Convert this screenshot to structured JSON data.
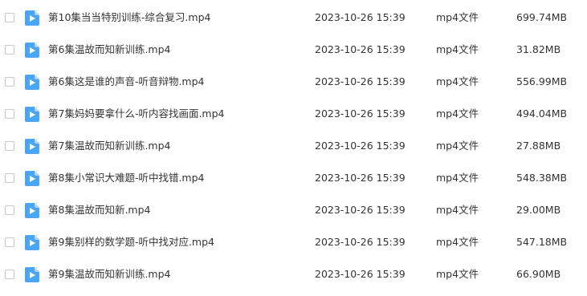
{
  "files": [
    {
      "name": "第10集当当特别训练-综合复习.mp4",
      "modified": "2023-10-26 15:39",
      "type": "mp4文件",
      "size": "699.74MB",
      "icon": "video-file-icon"
    },
    {
      "name": "第6集温故而知新训练.mp4",
      "modified": "2023-10-26 15:39",
      "type": "mp4文件",
      "size": "31.82MB",
      "icon": "video-file-icon"
    },
    {
      "name": "第6集这是谁的声音-听音辩物.mp4",
      "modified": "2023-10-26 15:39",
      "type": "mp4文件",
      "size": "556.99MB",
      "icon": "video-file-icon"
    },
    {
      "name": "第7集妈妈要拿什么-听内容找画面.mp4",
      "modified": "2023-10-26 15:39",
      "type": "mp4文件",
      "size": "494.04MB",
      "icon": "video-file-icon"
    },
    {
      "name": "第7集温故而知新训练.mp4",
      "modified": "2023-10-26 15:39",
      "type": "mp4文件",
      "size": "27.88MB",
      "icon": "video-file-icon"
    },
    {
      "name": "第8集小常识大难题-听中找错.mp4",
      "modified": "2023-10-26 15:39",
      "type": "mp4文件",
      "size": "548.38MB",
      "icon": "video-file-icon"
    },
    {
      "name": "第8集温故而知新.mp4",
      "modified": "2023-10-26 15:39",
      "type": "mp4文件",
      "size": "29.00MB",
      "icon": "video-file-icon"
    },
    {
      "name": "第9集别样的数学题-听中找对应.mp4",
      "modified": "2023-10-26 15:39",
      "type": "mp4文件",
      "size": "547.18MB",
      "icon": "video-file-icon"
    },
    {
      "name": "第9集温故而知新训练.mp4",
      "modified": "2023-10-26 15:39",
      "type": "mp4文件",
      "size": "66.90MB",
      "icon": "video-file-icon"
    }
  ],
  "colors": {
    "icon_fill": "#4aa6f5",
    "icon_fold": "#a9d4fb",
    "text": "#333333",
    "checkbox_border": "#c8c8c8"
  }
}
